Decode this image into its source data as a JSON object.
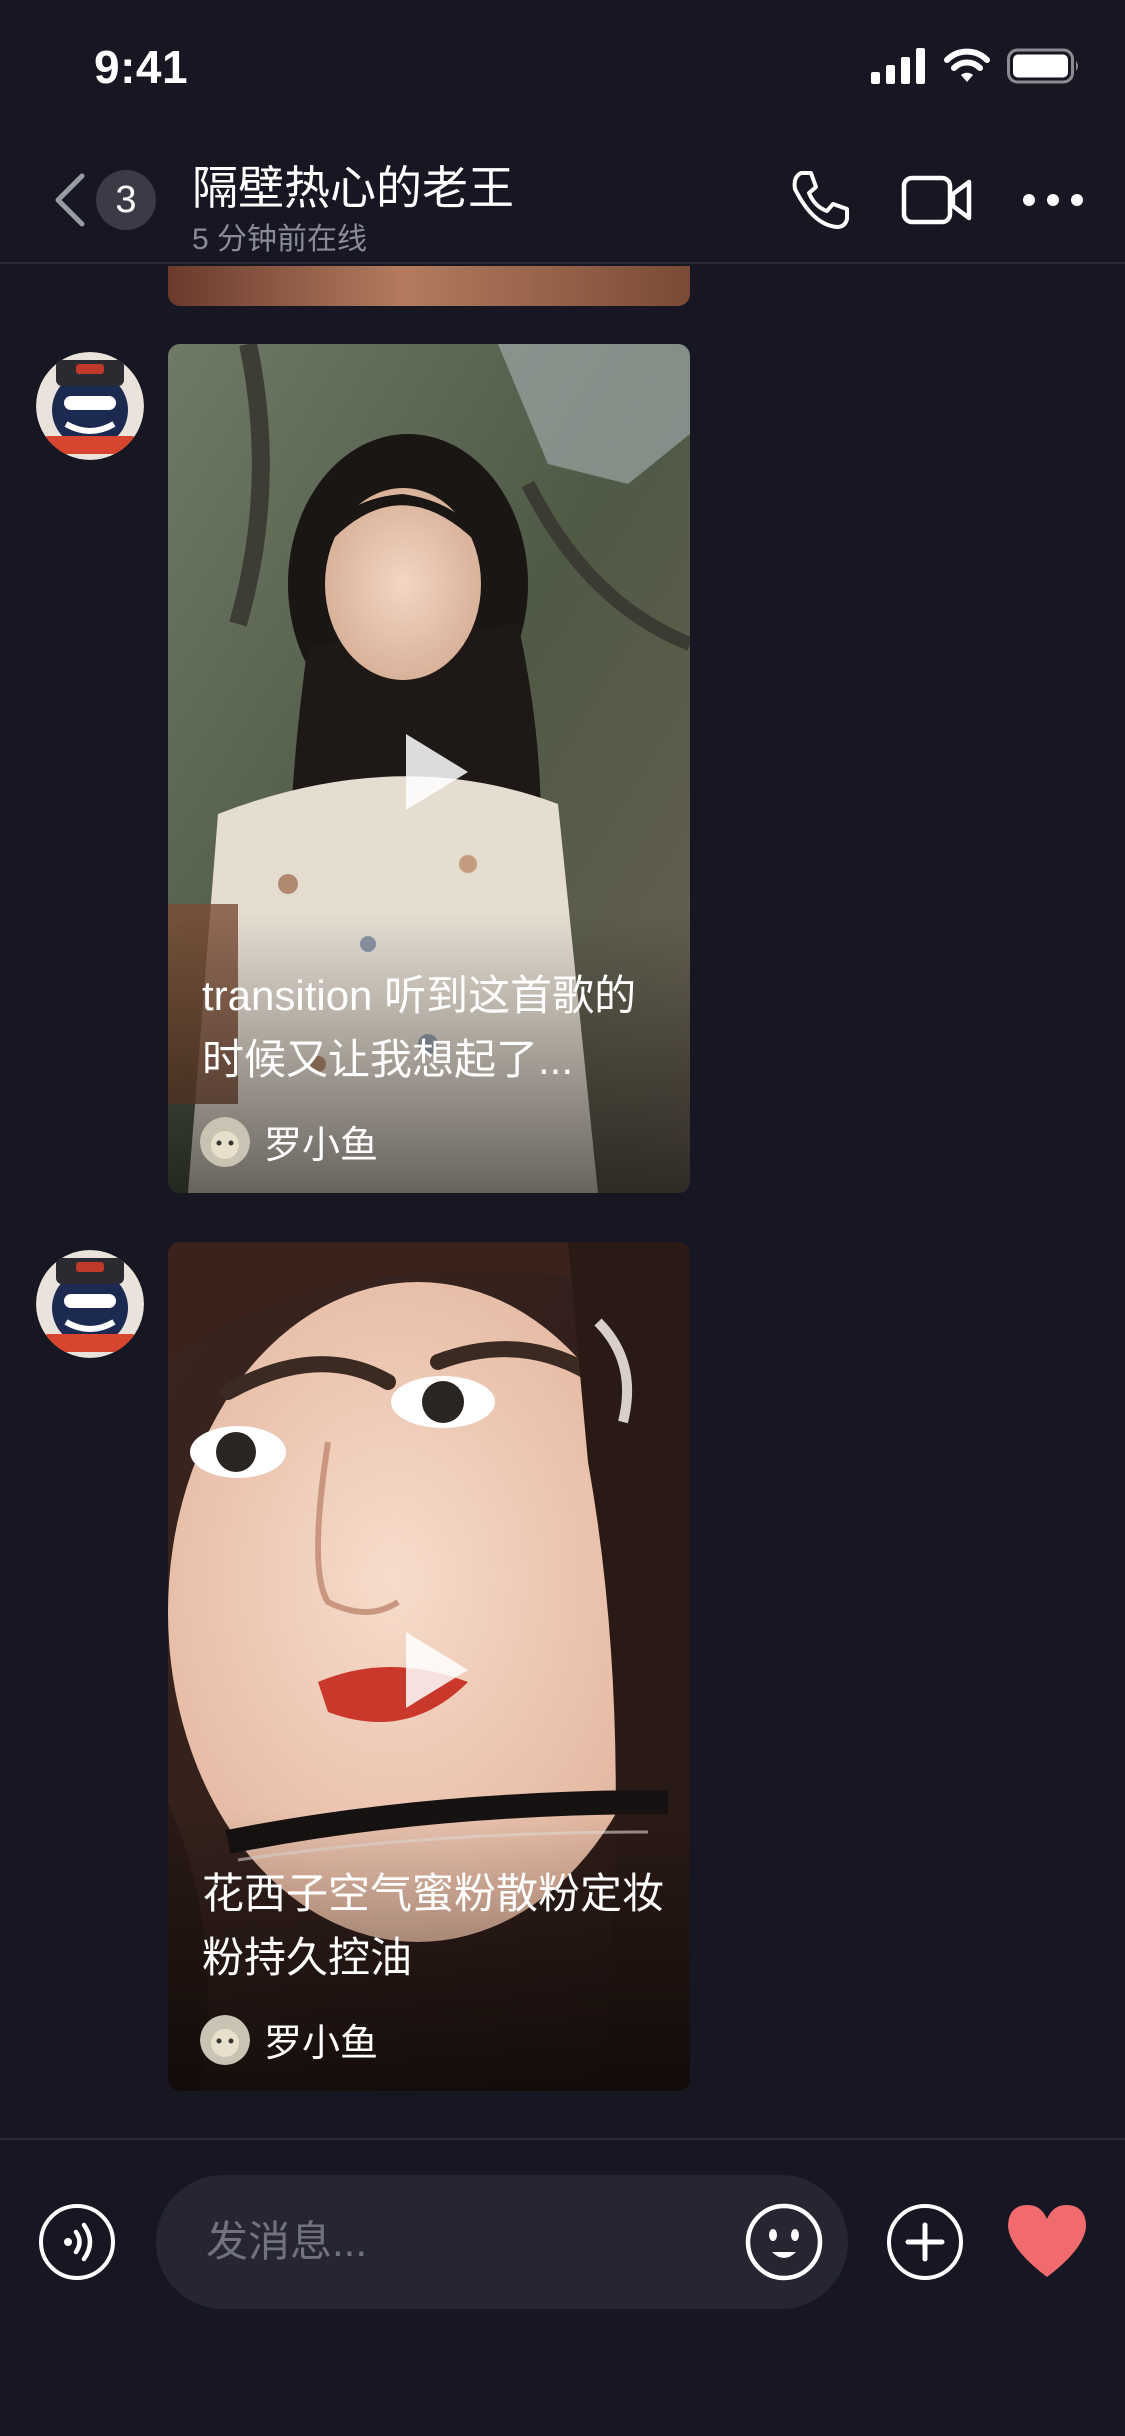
{
  "status_bar": {
    "time": "9:41"
  },
  "nav": {
    "back_badge": "3",
    "title": "隔壁热心的老王",
    "subtitle": "5 分钟前在线"
  },
  "messages": [
    {
      "text": "transition 听到这首歌的时候又让我想起了...",
      "author": "罗小鱼"
    },
    {
      "text": "花西子空气蜜粉散粉定妆粉持久控油",
      "author": "罗小鱼"
    }
  ],
  "input": {
    "placeholder": "发消息..."
  },
  "colors": {
    "background": "#161722",
    "input": "#252632",
    "heart": "#f06a6e"
  }
}
